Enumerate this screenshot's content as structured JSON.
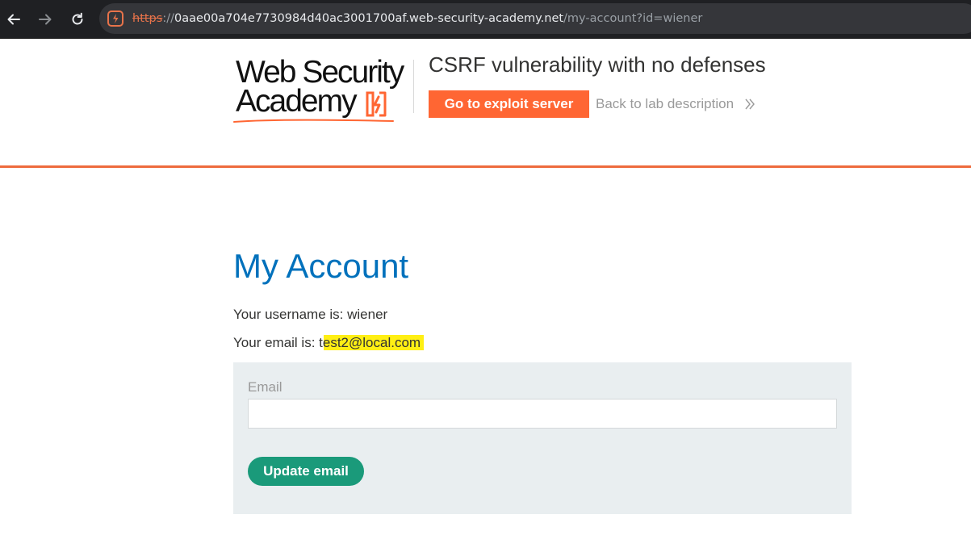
{
  "browser": {
    "url_scheme": "https",
    "url_separator": "://",
    "url_host": "0aae00a704e7730984d40ac3001700af.web-security-academy.net",
    "url_path": "/my-account?id=wiener",
    "icons": [
      "back-arrow-icon",
      "forward-arrow-icon",
      "reload-icon",
      "site-lightning-icon"
    ]
  },
  "header": {
    "logo_line1": "Web Security",
    "logo_line2": "Academy",
    "lab_title": "CSRF vulnerability with no defenses",
    "exploit_button_label": "Go to exploit server",
    "back_link_label": "Back to lab description",
    "accent_color": "#ff6633"
  },
  "main": {
    "page_title": "My Account",
    "username_prefix": "Your username is: ",
    "username": "wiener",
    "email_prefix": "Your email is: ",
    "email": "test2@local.com",
    "title_color": "#0071bc"
  },
  "form": {
    "email_label": "Email",
    "email_value": "",
    "update_button_label": "Update email",
    "button_color": "#1a9a7a"
  }
}
